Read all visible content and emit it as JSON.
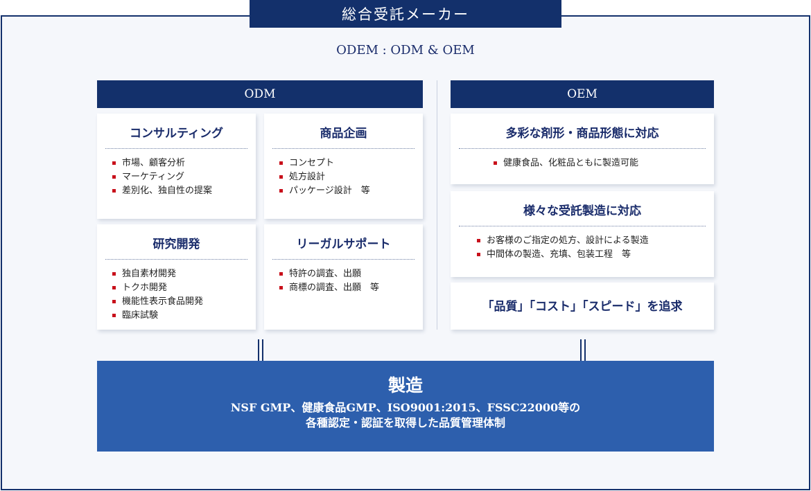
{
  "banner": {
    "title": "総合受託メーカー"
  },
  "subtitle": "ODEM : ODM & OEM",
  "odm": {
    "header": "ODM",
    "cards": [
      {
        "title": "コンサルティング",
        "items": [
          "市場、顧客分析",
          "マーケティング",
          "差別化、独自性の提案"
        ]
      },
      {
        "title": "商品企画",
        "items": [
          "コンセプト",
          "処方設計",
          "パッケージ設計　等"
        ]
      },
      {
        "title": "研究開発",
        "items": [
          "独自素材開発",
          "トクホ開発",
          "機能性表示食品開発",
          "臨床試験"
        ]
      },
      {
        "title": "リーガルサポート",
        "items": [
          "特許の調査、出願",
          "商標の調査、出願　等"
        ]
      }
    ]
  },
  "oem": {
    "header": "OEM",
    "cards": [
      {
        "title": "多彩な剤形・商品形態に対応",
        "items": [
          "健康食品、化粧品ともに製造可能"
        ]
      },
      {
        "title": "様々な受託製造に対応",
        "items": [
          "お客様のご指定の処方、設計による製造",
          "中間体の製造、充填、包装工程　等"
        ]
      }
    ],
    "pursuit": "「品質」「コスト」「スピード」を追求"
  },
  "manufacturing": {
    "title": "製造",
    "line1": "NSF GMP、健康食品GMP、ISO9001:2015、FSSC22000等の",
    "line2": "各種認定・認証を取得した品質管理体制"
  },
  "colors": {
    "navy": "#13306b",
    "blue": "#2d5fad",
    "bullet": "#c8101b",
    "background": "#f5f7fb"
  },
  "icons": [
    "down-arrow-icon",
    "square-bullet-icon"
  ]
}
